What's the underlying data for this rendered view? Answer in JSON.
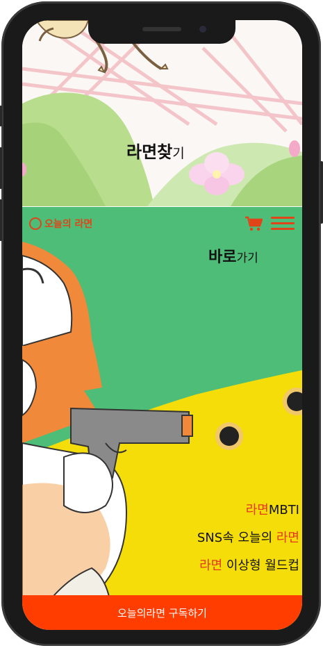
{
  "top": {
    "heading_main": "라면찾",
    "heading_small": "기"
  },
  "header": {
    "logo_text": "오늘의 라면",
    "cart_icon": "shopping-cart-icon",
    "menu_icon": "hamburger-menu-icon"
  },
  "shortcut": {
    "main": "바로",
    "small": "가기"
  },
  "links": [
    {
      "highlight": "라면",
      "text": "MBTI",
      "order": "highlight-first"
    },
    {
      "text": "SNS속 오늘의 ",
      "highlight": "라면",
      "order": "text-first"
    },
    {
      "highlight": "라면",
      "text": " 이상형 월드컵",
      "order": "highlight-first"
    }
  ],
  "subscribe": {
    "label": "오늘의라면 구독하기"
  },
  "colors": {
    "accent": "#e0451a",
    "subscribe_bar": "#ff3d00",
    "green": "#4dbd78",
    "yellow": "#f5dd0a"
  }
}
